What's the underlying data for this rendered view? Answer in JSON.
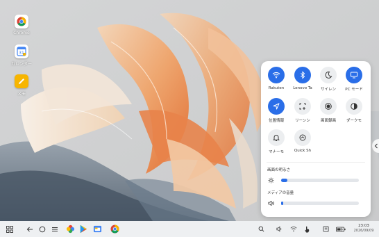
{
  "desktop": {
    "icons": [
      {
        "label": "Chrome",
        "icon": "chrome-icon"
      },
      {
        "label": "カレンダー",
        "icon": "calendar-icon"
      },
      {
        "label": "メモ",
        "icon": "notes-icon"
      }
    ]
  },
  "quick_settings": {
    "tiles": [
      {
        "label": "Rakuten",
        "icon": "wifi-icon",
        "state": "on"
      },
      {
        "label": "Lenovo Ta",
        "icon": "bluetooth-icon",
        "state": "on"
      },
      {
        "label": "サイレン",
        "icon": "moon-icon",
        "state": "off"
      },
      {
        "label": "PC モード",
        "icon": "monitor-icon",
        "state": "on"
      },
      {
        "label": "位置情報",
        "icon": "location-icon",
        "state": "on"
      },
      {
        "label": "リーンシ",
        "icon": "screenshot-icon",
        "state": "off"
      },
      {
        "label": "画面録画",
        "icon": "record-icon",
        "state": "off"
      },
      {
        "label": "ダークモ",
        "icon": "dark-mode-icon",
        "state": "off"
      },
      {
        "label": "マナーモ",
        "icon": "bell-icon",
        "state": "off"
      },
      {
        "label": "Quick Sh",
        "icon": "quick-share-icon",
        "state": "off"
      }
    ],
    "brightness": {
      "title": "画面の明るさ",
      "level": 0.08
    },
    "media_volume": {
      "title": "メディアの音量",
      "level": 0.03
    }
  },
  "taskbar": {
    "clock_time": "23:03",
    "clock_date": "2026/09/09"
  },
  "colors": {
    "accent": "#2a6ee8",
    "panel_bg": "#ffffff",
    "taskbar_bg": "#eef0f2"
  }
}
